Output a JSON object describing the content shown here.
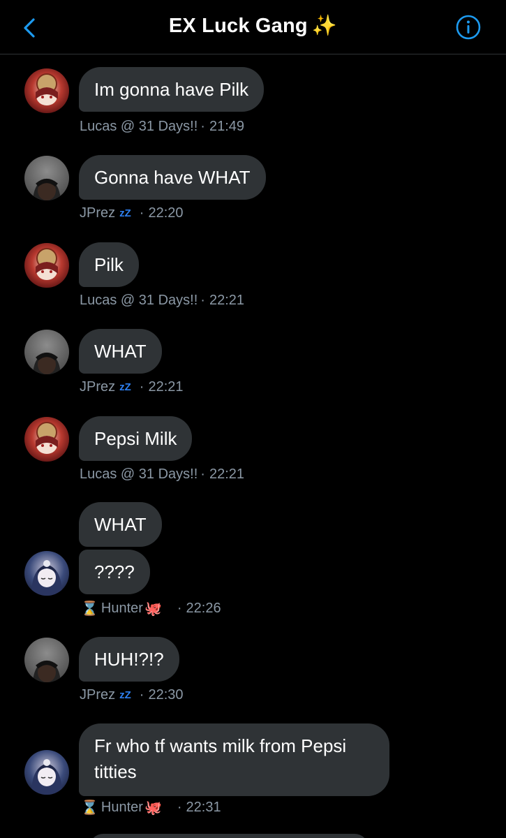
{
  "header": {
    "title": "EX Luck Gang",
    "title_emoji": "✨",
    "back_icon": "chevron-left-icon",
    "info_icon": "info-circle-icon"
  },
  "colors": {
    "accent": "#1d9bf0",
    "bubble": "#2f3336",
    "meta": "#8b98a5",
    "zz": "#2d7ff0"
  },
  "messages": [
    {
      "text": "Im gonna have Pilk",
      "sender": "Lucas @ 31 Days!!",
      "time": "21:49"
    },
    {
      "text": "Gonna have WHAT",
      "sender": "JPrez",
      "sender_suffix": "zZ",
      "time": "22:20"
    },
    {
      "text": "Pilk",
      "sender": "Lucas @ 31 Days!!",
      "time": "22:21"
    },
    {
      "text": "WHAT",
      "sender": "JPrez",
      "sender_suffix": "zZ",
      "time": "22:21"
    },
    {
      "text": "Pepsi Milk",
      "sender": "Lucas @ 31 Days!!",
      "time": "22:21"
    },
    {
      "text": "WHAT",
      "sender": "Hunter",
      "time": "22:26"
    },
    {
      "text": "????",
      "sender": "Hunter",
      "time": "22:26"
    },
    {
      "text": "HUH!?!?",
      "sender": "JPrez",
      "sender_suffix": "zZ",
      "time": "22:30"
    },
    {
      "text": "Fr who tf wants milk from Pepsi titties",
      "sender": "Hunter",
      "time": "22:31"
    }
  ],
  "meta": {
    "separator": "·",
    "hunter_prefix": "⌛",
    "hunter_suffix": "🐙"
  }
}
